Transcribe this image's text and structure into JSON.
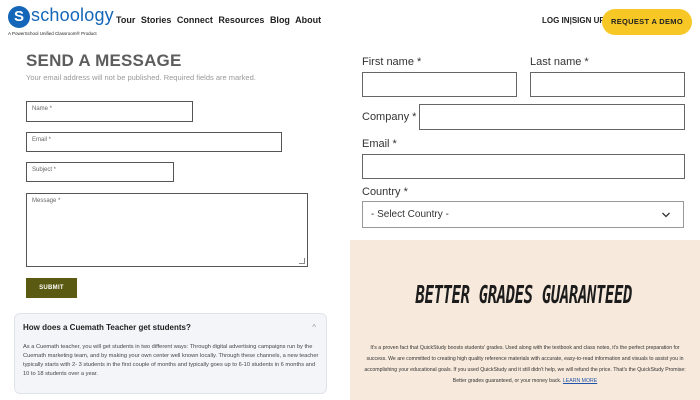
{
  "header": {
    "logo_initial": "S",
    "logo_name": "schoology",
    "logo_tagline": "A PowerSchool Unified Classroom® Product",
    "nav_items": [
      "Tour",
      "Stories",
      "Connect",
      "Resources",
      "Blog",
      "About"
    ],
    "login_label": "LOG IN",
    "signup_label": "SIGN UP",
    "login_separator": "|",
    "demo_button": "REQUEST A DEMO",
    "brand_color": "#1466b8",
    "accent_color": "#f7c825"
  },
  "send_message": {
    "title": "SEND A MESSAGE",
    "subtitle": "Your email address will not be published. Required fields are marked.",
    "name_placeholder": "Name *",
    "email_placeholder": "Email *",
    "subject_placeholder": "Subject *",
    "message_placeholder": "Message *",
    "submit_label": "SUBMIT",
    "submit_color": "#5b5a12"
  },
  "faq": {
    "question": "How does a Cuemath Teacher get students?",
    "chevron": "^",
    "answer": "As a Cuemath teacher, you will get students in two different ways: Through digital advertising campaigns run by the Cuemath marketing team, and by making your own center well known locally. Through these channels, a new teacher typically starts with 2- 3 students in the first couple of months and typically goes up to 6-10 students in 6 months and 10 to 18 students over a year."
  },
  "contact_form": {
    "first_name_label": "First name *",
    "last_name_label": "Last name *",
    "company_label": "Company *",
    "email_label": "Email *",
    "country_label": "Country *",
    "country_value": "- Select Country -"
  },
  "advert": {
    "title": "BETTER GRADES GUARANTEED",
    "body": "It's a proven fact that QuickStudy boosts students' grades. Used along with the textbook and class notes, it's the perfect preparation for success. We are committed to creating high quality reference materials with accurate, easy-to-read information and visuals to assist you in accomplishing your educational goals. If you used QuickStudy and it still didn't help, we will refund the price. That's the QuickStudy Promise: Better grades guaranteed, or your money back.",
    "link_label": "LEARN MORE",
    "background_color": "#f7e9db"
  }
}
